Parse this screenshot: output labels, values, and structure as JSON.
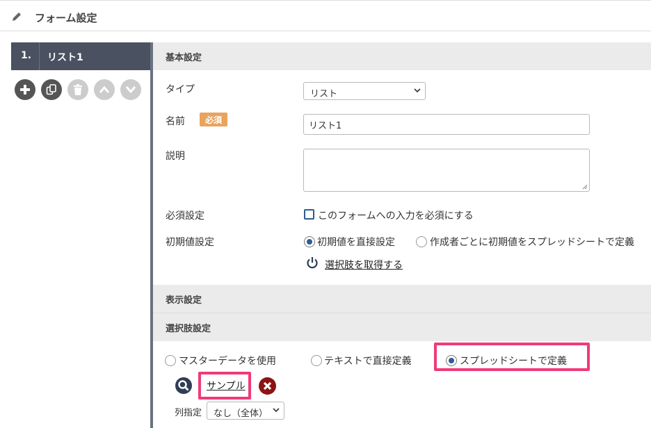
{
  "header": {
    "title": "フォーム設定",
    "icon": "pencil-icon"
  },
  "sidebar": {
    "item_number": "1.",
    "item_name": "リスト1",
    "actions": [
      "add-icon",
      "copy-icon",
      "trash-icon",
      "move-up-icon",
      "move-down-icon"
    ]
  },
  "sections": {
    "basic": "基本設定",
    "display": "表示設定",
    "choices": "選択肢設定"
  },
  "fields": {
    "type_label": "タイプ",
    "type_value": "リスト",
    "name_label": "名前",
    "required_badge": "必須",
    "name_value": "リスト1",
    "desc_label": "説明",
    "desc_value": "",
    "required_setting_label": "必須設定",
    "required_checkbox_text": "このフォームへの入力を必須にする",
    "initial_label": "初期値設定",
    "initial_opt1": "初期値を直接設定",
    "initial_opt2": "作成者ごとに初期値をスプレッドシートで定義",
    "fetch_link": "選択肢を取得する"
  },
  "choices": {
    "opt_master": "マスターデータを使用",
    "opt_text": "テキストで直接定義",
    "opt_sheet": "スプレッドシートで定義",
    "sample_link": "サンプル",
    "column_label": "列指定",
    "column_value": "なし（全体）"
  },
  "colors": {
    "highlight": "#f03a7a",
    "accent": "#2c5c94",
    "badge": "#e8a35d",
    "sidebar_head": "#4a5160"
  }
}
